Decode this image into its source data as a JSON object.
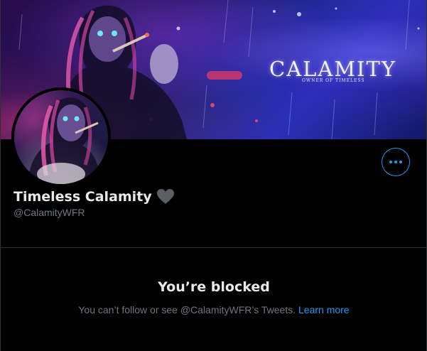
{
  "profile": {
    "banner_title": "CALAMITY",
    "banner_subtitle": "OWNER OF TIMELESS",
    "display_name": "Timeless Calamity",
    "handle": "@CalamityWFR",
    "name_emoji": "heart-icon"
  },
  "actions": {
    "more_icon": "more-horizontal-icon"
  },
  "blocked": {
    "title": "You’re blocked",
    "message_prefix": "You can’t follow or see @CalamityWFR’s Tweets.",
    "learn_more_label": "Learn more"
  },
  "colors": {
    "background": "#000000",
    "primary_text": "#e7e9ea",
    "secondary_text": "#71767b",
    "accent": "#1d9bf0",
    "divider": "#2f3336",
    "heart": "#5b5e62"
  }
}
